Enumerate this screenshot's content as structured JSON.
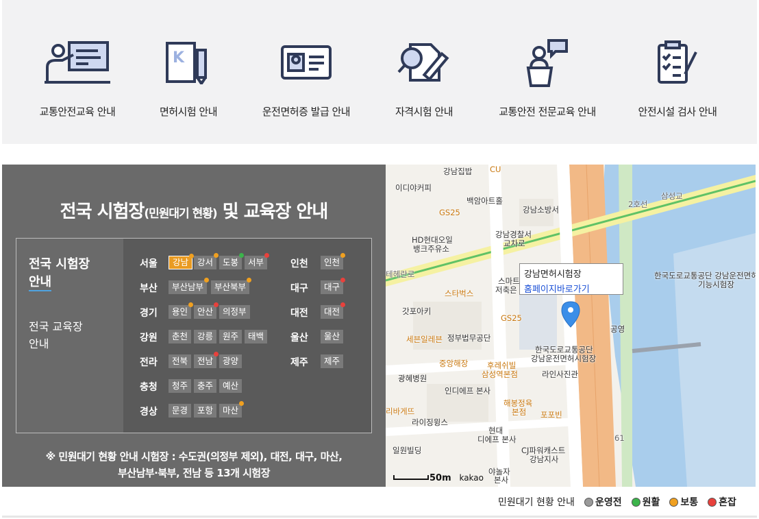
{
  "services": [
    {
      "label": "교통안전교육 안내",
      "icon": "lecture-board-icon"
    },
    {
      "label": "면허시험 안내",
      "icon": "license-book-pen-icon"
    },
    {
      "label": "운전면허증 발급 안내",
      "icon": "id-card-icon"
    },
    {
      "label": "자격시험 안내",
      "icon": "person-search-pen-icon"
    },
    {
      "label": "교통안전 전문교육 안내",
      "icon": "podium-speaker-icon"
    },
    {
      "label": "안전시설 검사 안내",
      "icon": "clipboard-checklist-icon"
    }
  ],
  "panel": {
    "title_main": "전국 시험장",
    "title_small": "(민원대기 현황)",
    "title_tail": " 및 교육장 안내",
    "tab_exam": [
      "전국 시험장",
      "안내"
    ],
    "tab_edu": [
      "전국 교육장",
      "안내"
    ],
    "note_line1": "※ 민원대기 현황 안내 시험장 : 수도권(의정부 제외), 대전, 대구, 마산,",
    "note_line2": "부산남부·북부, 전남 등 13개 시험장"
  },
  "regions": [
    {
      "name": "서울",
      "centers": [
        {
          "name": "강남",
          "status": "active"
        },
        {
          "name": "강서",
          "status": "normal"
        },
        {
          "name": "도봉",
          "status": "smooth"
        },
        {
          "name": "서부",
          "status": "crowded"
        }
      ]
    },
    {
      "name": "부산",
      "centers": [
        {
          "name": "부산남부",
          "status": "normal"
        },
        {
          "name": "부산북부",
          "status": "normal"
        }
      ]
    },
    {
      "name": "경기",
      "centers": [
        {
          "name": "용인",
          "status": "normal"
        },
        {
          "name": "안산",
          "status": "crowded"
        },
        {
          "name": "의정부",
          "status": ""
        }
      ]
    },
    {
      "name": "강원",
      "centers": [
        {
          "name": "춘천",
          "status": ""
        },
        {
          "name": "강릉",
          "status": ""
        },
        {
          "name": "원주",
          "status": ""
        },
        {
          "name": "태백",
          "status": ""
        }
      ]
    },
    {
      "name": "전라",
      "centers": [
        {
          "name": "전북",
          "status": ""
        },
        {
          "name": "전남",
          "status": "crowded"
        },
        {
          "name": "광양",
          "status": ""
        }
      ]
    },
    {
      "name": "충청",
      "centers": [
        {
          "name": "청주",
          "status": ""
        },
        {
          "name": "충주",
          "status": ""
        },
        {
          "name": "예산",
          "status": ""
        }
      ]
    },
    {
      "name": "경상",
      "centers": [
        {
          "name": "문경",
          "status": ""
        },
        {
          "name": "포항",
          "status": ""
        },
        {
          "name": "마산",
          "status": "normal"
        }
      ]
    },
    {
      "name": "인천",
      "centers": [
        {
          "name": "인천",
          "status": "normal"
        }
      ]
    },
    {
      "name": "대구",
      "centers": [
        {
          "name": "대구",
          "status": "crowded"
        }
      ]
    },
    {
      "name": "대전",
      "centers": [
        {
          "name": "대전",
          "status": "crowded"
        }
      ]
    },
    {
      "name": "울산",
      "centers": [
        {
          "name": "울산",
          "status": ""
        }
      ]
    },
    {
      "name": "제주",
      "centers": [
        {
          "name": "제주",
          "status": ""
        }
      ]
    }
  ],
  "status_colors": {
    "closed": "#9a9a9a",
    "smooth": "#3cb44b",
    "normal": "#f0a020",
    "crowded": "#e8413c"
  },
  "map": {
    "popup_title": "강남면허시험장",
    "popup_link": "홈페이지바로가기",
    "scale_label": "50m",
    "provider": "kakao",
    "labels": [
      {
        "text": "강남집밥",
        "cls": ""
      },
      {
        "text": "CU",
        "cls": "or"
      },
      {
        "text": "이디야커피",
        "cls": ""
      },
      {
        "text": "백암아트홀",
        "cls": ""
      },
      {
        "text": "강남소방서",
        "cls": ""
      },
      {
        "text": "GS25",
        "cls": "or"
      },
      {
        "text": "HD현대오일",
        "cls": ""
      },
      {
        "text": "뱅크주유소",
        "cls": ""
      },
      {
        "text": "강남경찰서",
        "cls": ""
      },
      {
        "text": "교차로",
        "cls": ""
      },
      {
        "text": "2호선",
        "cls": "st"
      },
      {
        "text": "삼성교",
        "cls": "st"
      },
      {
        "text": "테헤란로",
        "cls": "st"
      },
      {
        "text": "스타벅스",
        "cls": "or"
      },
      {
        "text": "스마트",
        "cls": ""
      },
      {
        "text": "저축은",
        "cls": ""
      },
      {
        "text": "갓포아키",
        "cls": ""
      },
      {
        "text": "GS25",
        "cls": "or"
      },
      {
        "text": "세븐일레븐",
        "cls": "or"
      },
      {
        "text": "정부법무공단",
        "cls": ""
      },
      {
        "text": "한국도로교통공단",
        "cls": ""
      },
      {
        "text": "강남운전면허시험장",
        "cls": ""
      },
      {
        "text": "중앙해장",
        "cls": "or"
      },
      {
        "text": "후레쉬빌",
        "cls": "or"
      },
      {
        "text": "삼성역본점",
        "cls": "or"
      },
      {
        "text": "라인사진관",
        "cls": ""
      },
      {
        "text": "광혜병원",
        "cls": ""
      },
      {
        "text": "인디에프 본사",
        "cls": ""
      },
      {
        "text": "해봉정육",
        "cls": "or"
      },
      {
        "text": "본점",
        "cls": "or"
      },
      {
        "text": "포포빈",
        "cls": "or"
      },
      {
        "text": "리바게뜨",
        "cls": "or"
      },
      {
        "text": "라이징윙스",
        "cls": ""
      },
      {
        "text": "현대",
        "cls": ""
      },
      {
        "text": "디에프 본사",
        "cls": ""
      },
      {
        "text": "일원빌딩",
        "cls": ""
      },
      {
        "text": "CJ파워캐스트",
        "cls": ""
      },
      {
        "text": "강남지사",
        "cls": ""
      },
      {
        "text": "야놀자",
        "cls": ""
      },
      {
        "text": "본사",
        "cls": ""
      },
      {
        "text": "공영",
        "cls": ""
      },
      {
        "text": "한국도로교통공단 강남운전면허",
        "cls": ""
      },
      {
        "text": "기능시험장",
        "cls": ""
      },
      {
        "text": "61",
        "cls": "st"
      }
    ]
  },
  "legend": {
    "title": "민원대기 현황 안내",
    "items": [
      {
        "label": "운영전",
        "color": "#9a9a9a"
      },
      {
        "label": "원활",
        "color": "#3cb44b"
      },
      {
        "label": "보통",
        "color": "#f0a020"
      },
      {
        "label": "혼잡",
        "color": "#e8413c"
      }
    ]
  }
}
